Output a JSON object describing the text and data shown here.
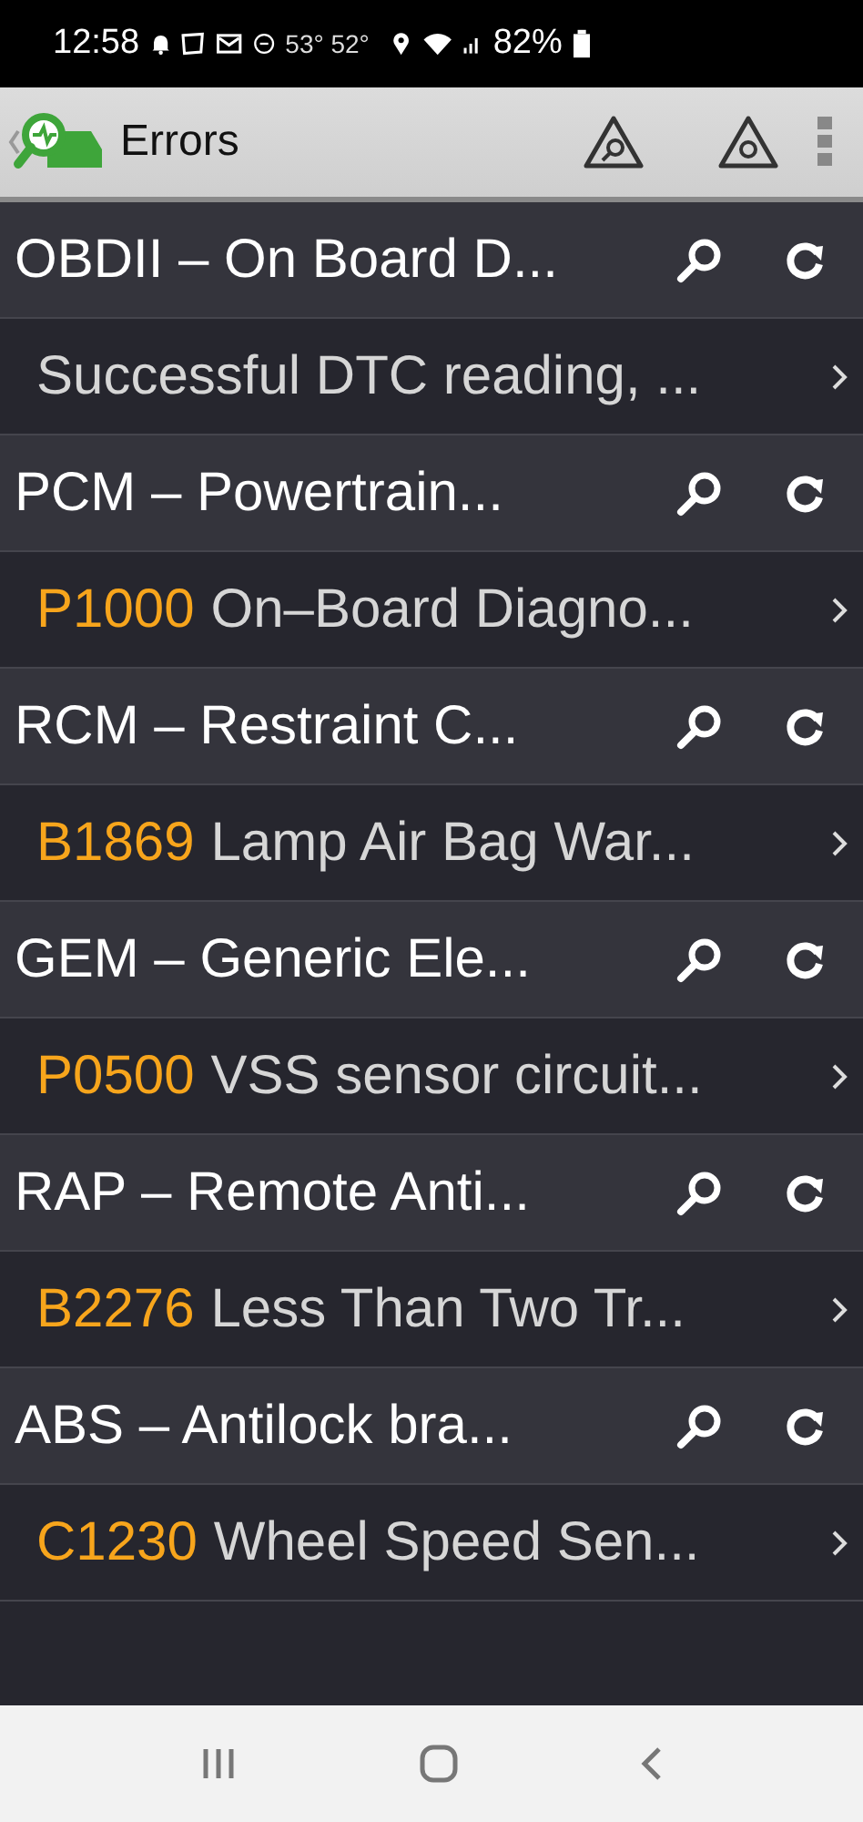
{
  "status_bar": {
    "time": "12:58",
    "weather": "53° 52°",
    "battery": "82%"
  },
  "app_bar": {
    "title": "Errors"
  },
  "modules": [
    {
      "name": "OBDII – On Board D...",
      "dtc": {
        "text": "Successful DTC reading, ..."
      }
    },
    {
      "name": "PCM – Powertrain...",
      "dtc": {
        "code": "P1000",
        "text": "On–Board Diagno..."
      }
    },
    {
      "name": "RCM – Restraint C...",
      "dtc": {
        "code": "B1869",
        "text": "Lamp Air Bag War..."
      }
    },
    {
      "name": "GEM – Generic Ele...",
      "dtc": {
        "code": "P0500",
        "text": "VSS sensor circuit..."
      }
    },
    {
      "name": "RAP – Remote Anti...",
      "dtc": {
        "code": "B2276",
        "text": "Less Than Two Tr..."
      }
    },
    {
      "name": "ABS – Antilock bra...",
      "dtc": {
        "code": "C1230",
        "text": "Wheel Speed Sen..."
      }
    }
  ]
}
